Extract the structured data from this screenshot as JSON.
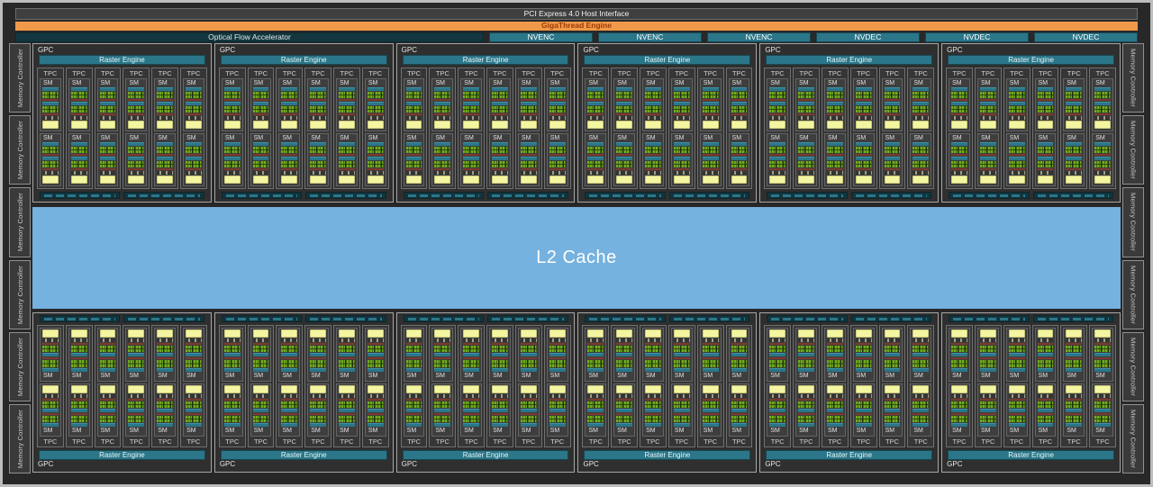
{
  "top_bars": {
    "pci": "PCI Express 4.0 Host Interface",
    "gigathread": "GigaThread Engine",
    "ofa": "Optical Flow Accelerator",
    "media_engines": [
      "NVENC",
      "NVENC",
      "NVENC",
      "NVDEC",
      "NVDEC",
      "NVDEC"
    ]
  },
  "memory": {
    "label": "Memory Controller",
    "left_count": 6,
    "right_count": 6
  },
  "l2": {
    "label": "L2 Cache"
  },
  "gpc": {
    "label": "GPC",
    "raster_label": "Raster Engine",
    "tpc_label": "TPC",
    "sm_label": "SM",
    "top_count": 6,
    "bottom_count": 6,
    "tpc_per_gpc": 6,
    "sm_per_tpc": 2,
    "rop_bars_per_gpc": 2
  },
  "colors": {
    "accent_orange": "#f0994a",
    "engine_teal": "#2b7689",
    "dark_teal": "#14373f",
    "core_green": "#6ba21d",
    "cache_yellow": "#f4f5a0",
    "separator_red": "#7c392b",
    "l2_blue": "#75b2df",
    "frame_gray": "#bdbdbd"
  }
}
